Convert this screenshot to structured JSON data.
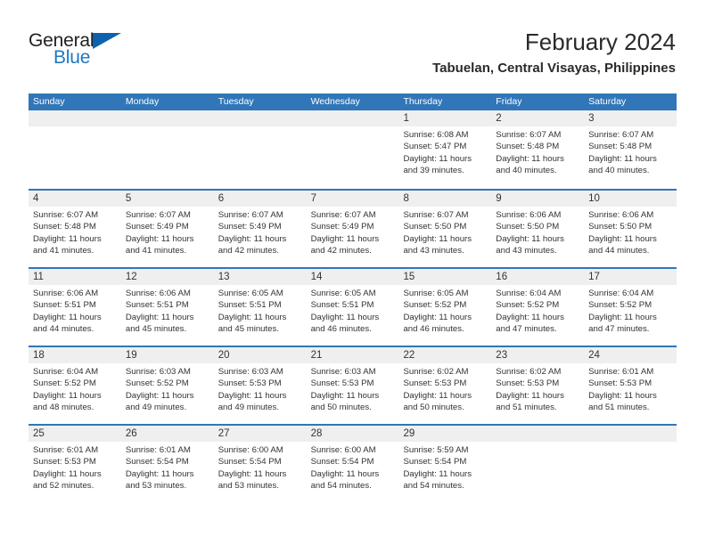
{
  "brand": {
    "name_part1": "General",
    "name_part2": "Blue",
    "triangle_icon": "triangle-logo-icon",
    "color_dark": "#231f20",
    "color_blue": "#2077c4",
    "color_triangle": "#0c63ad"
  },
  "header": {
    "title": "February 2024",
    "subtitle": "Tabuelan, Central Visayas, Philippines"
  },
  "theme": {
    "header_blue": "#3176b8",
    "daynum_band": "#efefef",
    "text": "#333333"
  },
  "weekdays": [
    "Sunday",
    "Monday",
    "Tuesday",
    "Wednesday",
    "Thursday",
    "Friday",
    "Saturday"
  ],
  "weeks": [
    [
      {
        "day": "",
        "lines": []
      },
      {
        "day": "",
        "lines": []
      },
      {
        "day": "",
        "lines": []
      },
      {
        "day": "",
        "lines": []
      },
      {
        "day": "1",
        "lines": [
          "Sunrise: 6:08 AM",
          "Sunset: 5:47 PM",
          "Daylight: 11 hours",
          "and 39 minutes."
        ]
      },
      {
        "day": "2",
        "lines": [
          "Sunrise: 6:07 AM",
          "Sunset: 5:48 PM",
          "Daylight: 11 hours",
          "and 40 minutes."
        ]
      },
      {
        "day": "3",
        "lines": [
          "Sunrise: 6:07 AM",
          "Sunset: 5:48 PM",
          "Daylight: 11 hours",
          "and 40 minutes."
        ]
      }
    ],
    [
      {
        "day": "4",
        "lines": [
          "Sunrise: 6:07 AM",
          "Sunset: 5:48 PM",
          "Daylight: 11 hours",
          "and 41 minutes."
        ]
      },
      {
        "day": "5",
        "lines": [
          "Sunrise: 6:07 AM",
          "Sunset: 5:49 PM",
          "Daylight: 11 hours",
          "and 41 minutes."
        ]
      },
      {
        "day": "6",
        "lines": [
          "Sunrise: 6:07 AM",
          "Sunset: 5:49 PM",
          "Daylight: 11 hours",
          "and 42 minutes."
        ]
      },
      {
        "day": "7",
        "lines": [
          "Sunrise: 6:07 AM",
          "Sunset: 5:49 PM",
          "Daylight: 11 hours",
          "and 42 minutes."
        ]
      },
      {
        "day": "8",
        "lines": [
          "Sunrise: 6:07 AM",
          "Sunset: 5:50 PM",
          "Daylight: 11 hours",
          "and 43 minutes."
        ]
      },
      {
        "day": "9",
        "lines": [
          "Sunrise: 6:06 AM",
          "Sunset: 5:50 PM",
          "Daylight: 11 hours",
          "and 43 minutes."
        ]
      },
      {
        "day": "10",
        "lines": [
          "Sunrise: 6:06 AM",
          "Sunset: 5:50 PM",
          "Daylight: 11 hours",
          "and 44 minutes."
        ]
      }
    ],
    [
      {
        "day": "11",
        "lines": [
          "Sunrise: 6:06 AM",
          "Sunset: 5:51 PM",
          "Daylight: 11 hours",
          "and 44 minutes."
        ]
      },
      {
        "day": "12",
        "lines": [
          "Sunrise: 6:06 AM",
          "Sunset: 5:51 PM",
          "Daylight: 11 hours",
          "and 45 minutes."
        ]
      },
      {
        "day": "13",
        "lines": [
          "Sunrise: 6:05 AM",
          "Sunset: 5:51 PM",
          "Daylight: 11 hours",
          "and 45 minutes."
        ]
      },
      {
        "day": "14",
        "lines": [
          "Sunrise: 6:05 AM",
          "Sunset: 5:51 PM",
          "Daylight: 11 hours",
          "and 46 minutes."
        ]
      },
      {
        "day": "15",
        "lines": [
          "Sunrise: 6:05 AM",
          "Sunset: 5:52 PM",
          "Daylight: 11 hours",
          "and 46 minutes."
        ]
      },
      {
        "day": "16",
        "lines": [
          "Sunrise: 6:04 AM",
          "Sunset: 5:52 PM",
          "Daylight: 11 hours",
          "and 47 minutes."
        ]
      },
      {
        "day": "17",
        "lines": [
          "Sunrise: 6:04 AM",
          "Sunset: 5:52 PM",
          "Daylight: 11 hours",
          "and 47 minutes."
        ]
      }
    ],
    [
      {
        "day": "18",
        "lines": [
          "Sunrise: 6:04 AM",
          "Sunset: 5:52 PM",
          "Daylight: 11 hours",
          "and 48 minutes."
        ]
      },
      {
        "day": "19",
        "lines": [
          "Sunrise: 6:03 AM",
          "Sunset: 5:52 PM",
          "Daylight: 11 hours",
          "and 49 minutes."
        ]
      },
      {
        "day": "20",
        "lines": [
          "Sunrise: 6:03 AM",
          "Sunset: 5:53 PM",
          "Daylight: 11 hours",
          "and 49 minutes."
        ]
      },
      {
        "day": "21",
        "lines": [
          "Sunrise: 6:03 AM",
          "Sunset: 5:53 PM",
          "Daylight: 11 hours",
          "and 50 minutes."
        ]
      },
      {
        "day": "22",
        "lines": [
          "Sunrise: 6:02 AM",
          "Sunset: 5:53 PM",
          "Daylight: 11 hours",
          "and 50 minutes."
        ]
      },
      {
        "day": "23",
        "lines": [
          "Sunrise: 6:02 AM",
          "Sunset: 5:53 PM",
          "Daylight: 11 hours",
          "and 51 minutes."
        ]
      },
      {
        "day": "24",
        "lines": [
          "Sunrise: 6:01 AM",
          "Sunset: 5:53 PM",
          "Daylight: 11 hours",
          "and 51 minutes."
        ]
      }
    ],
    [
      {
        "day": "25",
        "lines": [
          "Sunrise: 6:01 AM",
          "Sunset: 5:53 PM",
          "Daylight: 11 hours",
          "and 52 minutes."
        ]
      },
      {
        "day": "26",
        "lines": [
          "Sunrise: 6:01 AM",
          "Sunset: 5:54 PM",
          "Daylight: 11 hours",
          "and 53 minutes."
        ]
      },
      {
        "day": "27",
        "lines": [
          "Sunrise: 6:00 AM",
          "Sunset: 5:54 PM",
          "Daylight: 11 hours",
          "and 53 minutes."
        ]
      },
      {
        "day": "28",
        "lines": [
          "Sunrise: 6:00 AM",
          "Sunset: 5:54 PM",
          "Daylight: 11 hours",
          "and 54 minutes."
        ]
      },
      {
        "day": "29",
        "lines": [
          "Sunrise: 5:59 AM",
          "Sunset: 5:54 PM",
          "Daylight: 11 hours",
          "and 54 minutes."
        ]
      },
      {
        "day": "",
        "lines": []
      },
      {
        "day": "",
        "lines": []
      }
    ]
  ]
}
